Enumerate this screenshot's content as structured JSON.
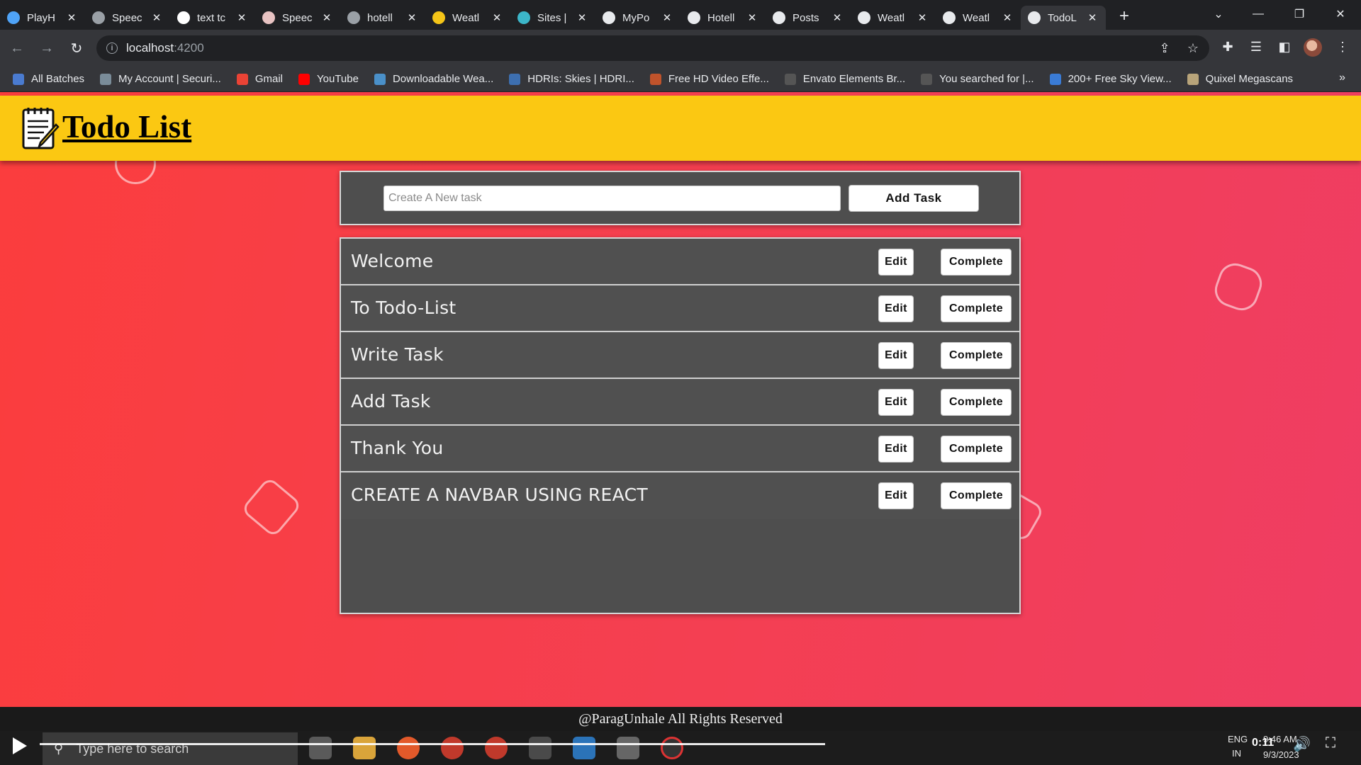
{
  "browser": {
    "tabs": [
      {
        "label": "PlayH",
        "icon": "play-circle-icon",
        "color": "#4fa3f7"
      },
      {
        "label": "Speec",
        "icon": "speech-icon",
        "color": "#9aa0a6"
      },
      {
        "label": "text tc",
        "icon": "google-icon",
        "color": "#ffffff"
      },
      {
        "label": "Speec",
        "icon": "speech-icon",
        "color": "#e8c3c3"
      },
      {
        "label": "hotell",
        "icon": "page-icon",
        "color": "#9aa0a6"
      },
      {
        "label": "Weatl",
        "icon": "hand-icon",
        "color": "#f5c518"
      },
      {
        "label": "Sites |",
        "icon": "sites-diamond-icon",
        "color": "#3cb6c9"
      },
      {
        "label": "MyPo",
        "icon": "angular-icon",
        "color": "#e8eaed"
      },
      {
        "label": "Hotell",
        "icon": "angular-icon",
        "color": "#e8eaed"
      },
      {
        "label": "Posts",
        "icon": "angular-icon",
        "color": "#e8eaed"
      },
      {
        "label": "Weatl",
        "icon": "angular-icon",
        "color": "#e8eaed"
      },
      {
        "label": "Weatl",
        "icon": "angular-icon",
        "color": "#e8eaed"
      },
      {
        "label": "TodoL",
        "icon": "angular-icon",
        "color": "#e8eaed",
        "active": true
      }
    ],
    "close_glyph": "✕",
    "new_tab_glyph": "+",
    "address": {
      "host": "localhost",
      "port": ":4200"
    },
    "bookmarks": [
      {
        "label": "All Batches",
        "color": "#4a7bd0"
      },
      {
        "label": "My Account | Securi...",
        "color": "#7a8c99"
      },
      {
        "label": "Gmail",
        "color": "#ea4335"
      },
      {
        "label": "YouTube",
        "color": "#ff0000"
      },
      {
        "label": "Downloadable Wea...",
        "color": "#4a90c9"
      },
      {
        "label": "HDRIs: Skies | HDRI...",
        "color": "#3d6fb0"
      },
      {
        "label": "Free HD Video Effe...",
        "color": "#c0532b"
      },
      {
        "label": "Envato Elements Br...",
        "color": "#555555"
      },
      {
        "label": "You searched for |...",
        "color": "#555555"
      },
      {
        "label": "200+ Free Sky View...",
        "color": "#3a7bd5"
      },
      {
        "label": "Quixel Megascans",
        "color": "#b8a47a"
      }
    ],
    "more_glyph": "»"
  },
  "app": {
    "title": "Todo List",
    "input_placeholder": "Create A New task",
    "add_button": "Add Task",
    "edit_label": "Edit",
    "complete_label": "Complete",
    "tasks": [
      "Welcome",
      "To Todo-List",
      "Write Task",
      "Add Task",
      "Thank You",
      "CREATE A NAVBAR USING REACT"
    ],
    "footer": "@ParagUnhale All Rights Reserved",
    "colors": {
      "header": "#fbc812",
      "background": "#f43f52",
      "panel": "#4e4e4e"
    }
  },
  "taskbar": {
    "search_placeholder": "Type here to search",
    "video_time": "0:11",
    "tray_lang": "ENG",
    "tray_region": "IN",
    "clock_time": "9:46 AM",
    "clock_date": "9/3/2023"
  }
}
